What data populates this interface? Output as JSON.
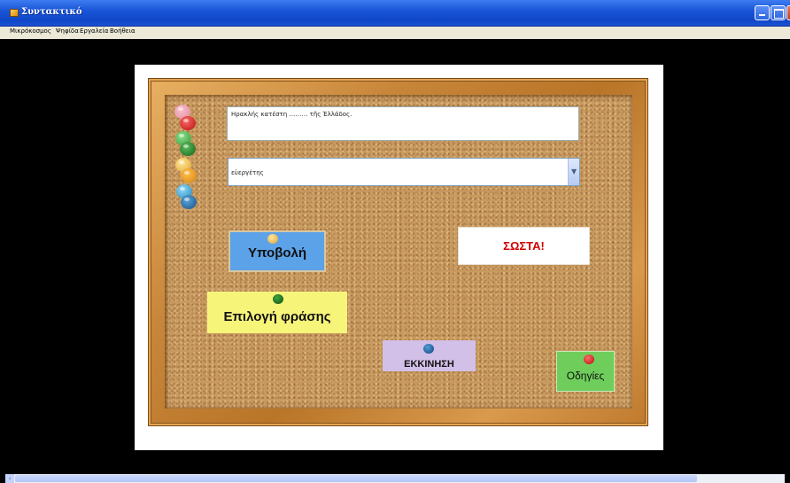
{
  "window": {
    "title": "Συντακτικό",
    "app_icon": "app-icon",
    "controls": [
      "minimize-icon",
      "maximize-icon",
      "close-icon"
    ]
  },
  "menubar": {
    "items": [
      "Μικρόκοσμος",
      "Ψηφίδα",
      "Εργαλεία",
      "Βοήθεια"
    ]
  },
  "board": {
    "sentence": "Ηρακλής κατέστη ……… τῆς Ἑλλάδος.",
    "dropdown_value": "εὐεργέτης",
    "dropdown_icon": "chevron-down-icon",
    "submit_label": "Υποβολή",
    "result_label": "ΣΩΣΤΑ!",
    "choose_label": "Επιλογή φράσης",
    "start_label": "ΕΚΚΙΝΗΣΗ",
    "guide_label": "Οδηγίες"
  },
  "colors": {
    "result_text": "#d10000",
    "submit_card": "#5ca2e8",
    "choose_card": "#f7f47a",
    "start_card": "#d2c0e8",
    "guide_card": "#6fce5b",
    "titlebar": "#1a55d8"
  }
}
